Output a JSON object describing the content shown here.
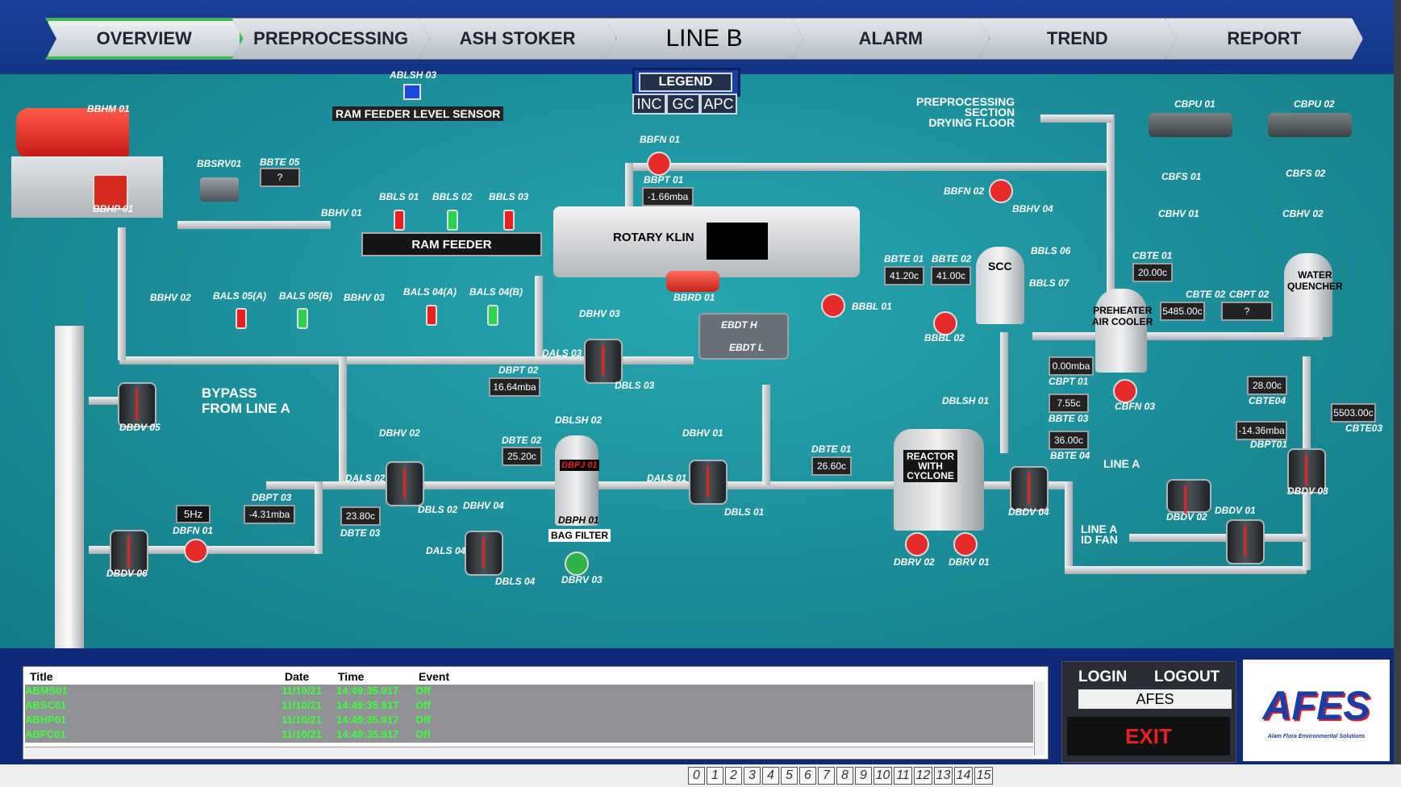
{
  "tabs": [
    {
      "label": "OVERVIEW",
      "active": true
    },
    {
      "label": "PREPROCESSING"
    },
    {
      "label": "ASH STOKER"
    },
    {
      "label": "LINE B",
      "center": true
    },
    {
      "label": "ALARM"
    },
    {
      "label": "TREND"
    },
    {
      "label": "REPORT"
    }
  ],
  "legend": {
    "title": "LEGEND",
    "buttons": [
      "INC",
      "GC",
      "APC"
    ]
  },
  "equipment": {
    "bbhm01": "BBHM 01",
    "bbhp01": "BBHP 01",
    "ablsh03": "ABLSH 03",
    "ram_sensor": "RAM FEEDER LEVEL SENSOR",
    "bbsrv01": "BBSRV01",
    "bbte05": "BBTE 05",
    "bbhv01": "BBHV 01",
    "bbls01": "BBLS 01",
    "bbls02": "BBLS 02",
    "bbls03": "BBLS 03",
    "ram_feeder": "RAM FEEDER",
    "rotary_kiln": "ROTARY KLIN",
    "bbfn01": "BBFN 01",
    "bbpt01": "BBPT 01",
    "bbrd01": "BBRD 01",
    "bbhv02": "BBHV 02",
    "bals05a": "BALS 05(A)",
    "bals05b": "BALS 05(B)",
    "bbhv03": "BBHV 03",
    "bals04a": "BALS 04(A)",
    "bals04b": "BALS 04(B)",
    "preproc": "PREPROCESSING\nSECTION\nDRYING FLOOR",
    "bbfn02": "BBFN 02",
    "bbhv04": "BBHV 04",
    "bbte01": "BBTE 01",
    "bbte02": "BBTE 02",
    "scc": "SCC",
    "bbls06": "BBLS 06",
    "bbls07": "BBLS 07",
    "bbbl01": "BBBL 01",
    "bbbl02": "BBBL 02",
    "ebdt_h": "EBDT H",
    "ebdt_l": "EBDT L",
    "cbpu01": "CBPU 01",
    "cbpu02": "CBPU 02",
    "cbfs01": "CBFS 01",
    "cbfs02": "CBFS 02",
    "cbhv01": "CBHV 01",
    "cbhv02": "CBHV 02",
    "cbte01": "CBTE 01",
    "cbte02": "CBTE 02",
    "cbpt02": "CBPT 02",
    "preheater": "PREHEATER\nAIR COOLER",
    "water_quencher": "WATER\nQUENCHER",
    "cbpt01": "CBPT 01",
    "bbte03": "BBTE 03",
    "bbte04": "BBTE 04",
    "cbfn03": "CBFN 03",
    "cbte04": "CBTE04",
    "cbte03": "CBTE03",
    "dbpt01": "DBPT01",
    "dbhv03": "DBHV 03",
    "dals03": "DALS 03",
    "dbls03": "DBLS 03",
    "dbpt02": "DBPT 02",
    "dbdv05": "DBDV 05",
    "bypass": "BYPASS\nFROM LINE A",
    "dblsh02": "DBLSH 02",
    "dbte02": "DBTE 02",
    "dbpj01": "DBPJ 01",
    "dbph01": "DBPH 01",
    "bag_filter": "BAG FILTER",
    "dbrv03": "DBRV 03",
    "dbhv02": "DBHV 02",
    "dals02": "DALS 02",
    "dbls02": "DBLS 02",
    "dbhv04": "DBHV 04",
    "dals04": "DALS 04",
    "dbls04": "DBLS 04",
    "dbhv01": "DBHV 01",
    "dals01": "DALS 01",
    "dbls01": "DBLS 01",
    "dbte01": "DBTE 01",
    "dblsh01": "DBLSH 01",
    "reactor": "REACTOR\nWITH\nCYCLONE",
    "dbrv02": "DBRV 02",
    "dbrv01": "DBRV 01",
    "dbdv04": "DBDV 04",
    "line_a": "LINE A",
    "dbdv02": "DBDV 02",
    "dbdv01": "DBDV 01",
    "line_a_id": "LINE A\nID FAN",
    "dbdv03": "DBDV 03",
    "dbpt03": "DBPT 03",
    "dbte03": "DBTE 03",
    "dbfn01": "DBFN 01",
    "dbdv06": "DBDV 06"
  },
  "readouts": {
    "bbte05": "?",
    "bbpt01": "-1.66mba",
    "bbte01": "41.20c",
    "bbte02": "41.00c",
    "cbte01": "20.00c",
    "cbte02": "5485.00c",
    "cbpt02": "?",
    "cbpt01": "0.00mba",
    "bbte03": "7.55c",
    "bbte04": "36.00c",
    "cbte04": "28.00c",
    "dbpt01": "-14.36mba",
    "cbte03": "5503.00c",
    "dbpt02": "16.64mba",
    "dbte02": "25.20c",
    "dbte01": "26.60c",
    "dbpt03": "-4.31mba",
    "dbte03": "23.80c",
    "freq": "5Hz"
  },
  "events": {
    "headers": [
      "Title",
      "Date",
      "Time",
      "Event"
    ],
    "rows": [
      [
        "ABMS01",
        "11/10/21",
        "14:49:35.917",
        "Off"
      ],
      [
        "ABSC01",
        "11/10/21",
        "14:49:35.917",
        "Off"
      ],
      [
        "ABHP01",
        "11/10/21",
        "14:49:35.917",
        "Off"
      ],
      [
        "ABFC01",
        "11/10/21",
        "14:49:35.917",
        "Off"
      ]
    ]
  },
  "login": {
    "login": "LOGIN",
    "logout": "LOGOUT",
    "user": "AFES",
    "exit": "EXIT"
  },
  "logo": {
    "text": "AFES",
    "sub": "Alam Flora Environmental Solutions"
  },
  "pages": [
    "0",
    "1",
    "2",
    "3",
    "4",
    "5",
    "6",
    "7",
    "8",
    "9",
    "10",
    "11",
    "12",
    "13",
    "14",
    "15"
  ]
}
